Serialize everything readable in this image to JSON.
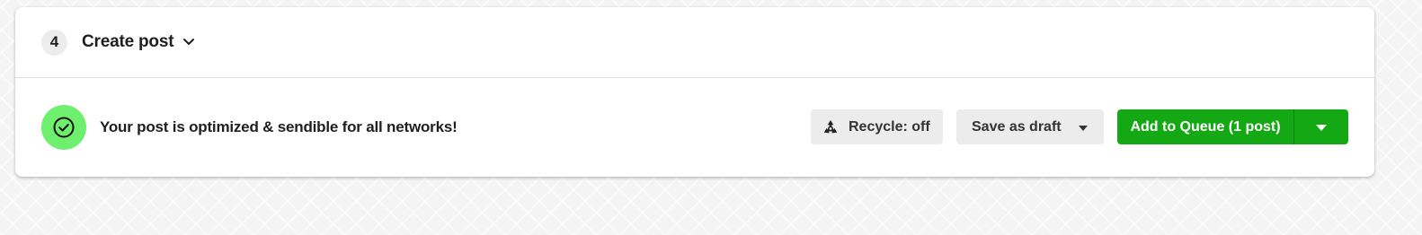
{
  "header": {
    "step_number": "4",
    "title": "Create post"
  },
  "status": {
    "message": "Your post is optimized & sendible for all networks!",
    "icon": "check-circle-icon",
    "icon_bg": "#6ef06e"
  },
  "actions": {
    "recycle_label": "Recycle: off",
    "save_draft_label": "Save as draft",
    "add_queue_label": "Add to Queue (1 post)"
  },
  "colors": {
    "primary_green": "#15a815",
    "secondary_button": "#ececec"
  }
}
